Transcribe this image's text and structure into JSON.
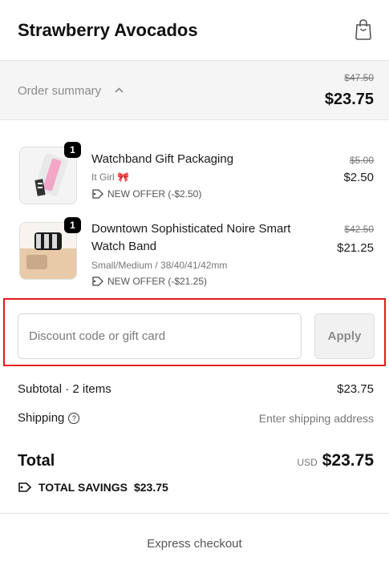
{
  "header": {
    "brand": "Strawberry Avocados",
    "cart_icon": "shopping-bag-icon"
  },
  "summary": {
    "label": "Order summary",
    "original_total": "$47.50",
    "total": "$23.75",
    "toggle_icon": "chevron-up-icon"
  },
  "items": [
    {
      "quantity": "1",
      "title": "Watchband Gift Packaging",
      "variant": "It Girl 🎀",
      "offer": "NEW OFFER (-$2.50)",
      "original_price": "$5.00",
      "price": "$2.50"
    },
    {
      "quantity": "1",
      "title": "Downtown Sophisticated Noire Smart Watch Band",
      "variant": "Small/Medium / 38/40/41/42mm",
      "offer": "NEW OFFER (-$21.25)",
      "original_price": "$42.50",
      "price": "$21.25"
    }
  ],
  "discount": {
    "placeholder": "Discount code or gift card",
    "value": "",
    "apply_label": "Apply"
  },
  "totals": {
    "subtotal_label": "Subtotal · 2 items",
    "subtotal_value": "$23.75",
    "shipping_label": "Shipping",
    "shipping_value": "Enter shipping address",
    "total_label": "Total",
    "currency": "USD",
    "total_value": "$23.75",
    "savings_label": "TOTAL SAVINGS",
    "savings_value": "$23.75"
  },
  "footer": {
    "express_checkout": "Express checkout"
  },
  "colors": {
    "highlight_border": "#e41b1b",
    "summary_bg": "#f5f5f5"
  }
}
